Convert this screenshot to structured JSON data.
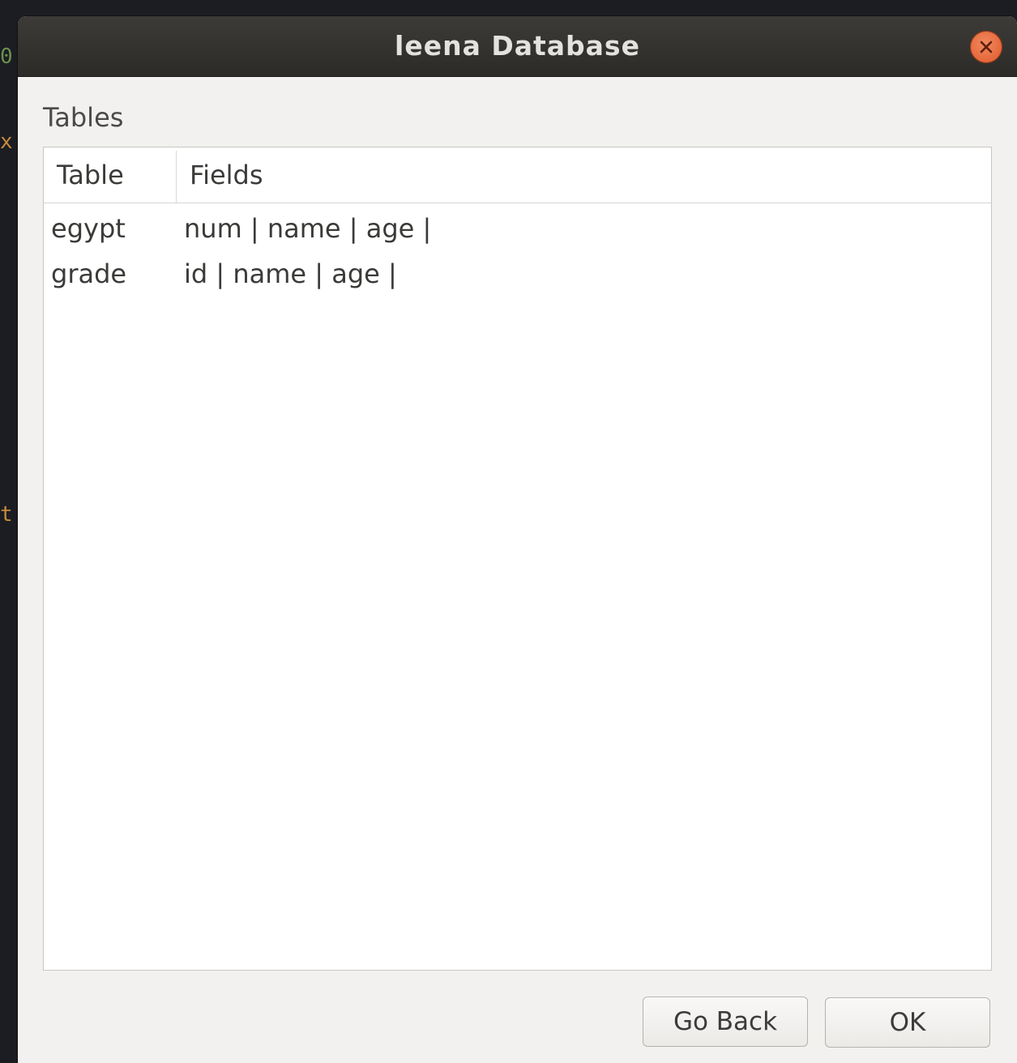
{
  "window": {
    "title": "leena Database"
  },
  "tables_section": {
    "label": "Tables",
    "columns": [
      "Table",
      "Fields"
    ],
    "rows": [
      {
        "table": "egypt",
        "fields": "num | name | age |"
      },
      {
        "table": "grade",
        "fields": "id | name | age |"
      }
    ]
  },
  "buttons": {
    "go_back": "Go Back",
    "ok": "OK"
  },
  "icons": {
    "close": "close-icon"
  },
  "colors": {
    "titlebar": "#2c2b28",
    "close_button": "#e0562b",
    "dialog_background": "#f2f1f0"
  }
}
